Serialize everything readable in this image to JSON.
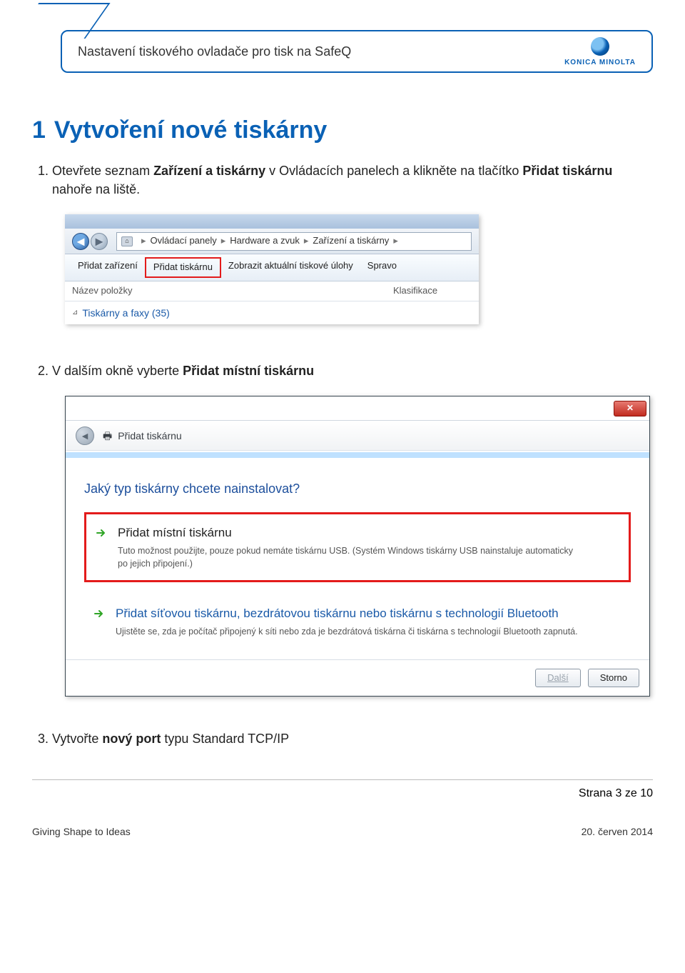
{
  "header": {
    "title": "Nastavení tiskového ovladače pro tisk na SafeQ",
    "brand": "KONICA MINOLTA"
  },
  "section": {
    "num": "1",
    "title": "Vytvoření nové tiskárny"
  },
  "steps": {
    "s1": {
      "pre": "Otevřete seznam ",
      "b1": "Zařízení a tiskárny",
      "mid1": " v Ovládacích panelech a klikněte na tlačítko ",
      "b2": "Přidat tiskárnu",
      "post": " nahoře na liště."
    },
    "s2": {
      "pre": "V dalším okně vyberte ",
      "b1": "Přidat místní tiskárnu"
    },
    "s3": {
      "pre": "Vytvořte ",
      "b1": "nový port",
      "post": " typu Standard TCP/IP"
    }
  },
  "shot1": {
    "crumbs": [
      "Ovládací panely",
      "Hardware a zvuk",
      "Zařízení a tiskárny"
    ],
    "toolbar": {
      "addDevice": "Přidat zařízení",
      "addPrinter": "Přidat tiskárnu",
      "showJobs": "Zobrazit aktuální tiskové úlohy",
      "manage": "Spravo"
    },
    "cols": {
      "name": "Název položky",
      "classification": "Klasifikace"
    },
    "category": "Tiskárny a faxy (35)"
  },
  "shot2": {
    "title": "Přidat tiskárnu",
    "heading": "Jaký typ tiskárny chcete nainstalovat?",
    "opt1": {
      "title": "Přidat místní tiskárnu",
      "desc": "Tuto možnost použijte, pouze pokud nemáte tiskárnu USB. (Systém Windows tiskárny USB nainstaluje automaticky po jejich připojení.)"
    },
    "opt2": {
      "title": "Přidat síťovou tiskárnu, bezdrátovou tiskárnu nebo tiskárnu s technologií Bluetooth",
      "desc": "Ujistěte se, zda je počítač připojený k síti nebo zda je bezdrátová tiskárna či tiskárna s technologií Bluetooth zapnutá."
    },
    "buttons": {
      "next": "Další",
      "cancel": "Storno"
    }
  },
  "footer": {
    "pageLine": "Strana 3 ze 10",
    "left": "Giving Shape to Ideas",
    "right": "20. červen  2014"
  },
  "glyphs": {
    "back": "◄",
    "fwd": "►",
    "sep": "▸",
    "caret": "⊿"
  }
}
